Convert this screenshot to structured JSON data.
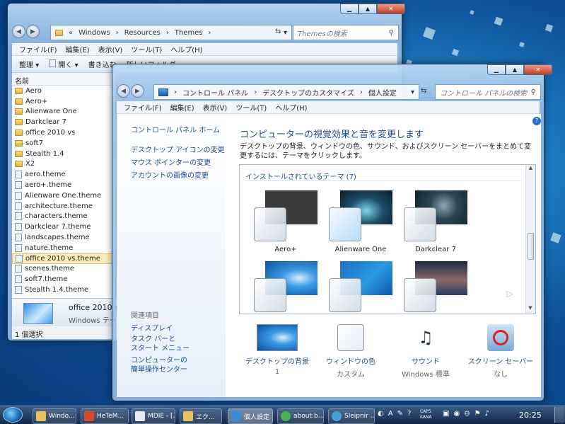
{
  "explorer": {
    "breadcrumb": [
      "«",
      "Windows",
      "Resources",
      "Themes"
    ],
    "search_placeholder": "Themesの検索",
    "menu": [
      "ファイル(F)",
      "編集(E)",
      "表示(V)",
      "ツール(T)",
      "ヘルプ(H)"
    ],
    "toolbar": {
      "organize": "整理",
      "open": "開く",
      "burn": "書き込む",
      "new_folder": "新しいフォルダー"
    },
    "column_name": "名前",
    "items": [
      {
        "name": "Aero",
        "type": "folder"
      },
      {
        "name": "Aero+",
        "type": "folder"
      },
      {
        "name": "Alienware One",
        "type": "folder"
      },
      {
        "name": "Darkclear 7",
        "type": "folder"
      },
      {
        "name": "office 2010 vs",
        "type": "folder"
      },
      {
        "name": "soft7",
        "type": "folder"
      },
      {
        "name": "Stealth 1.4",
        "type": "folder"
      },
      {
        "name": "X2",
        "type": "folder"
      },
      {
        "name": "aero.theme",
        "type": "file"
      },
      {
        "name": "aero+.theme",
        "type": "file"
      },
      {
        "name": "Alienware One.theme",
        "type": "file"
      },
      {
        "name": "architecture.theme",
        "type": "file"
      },
      {
        "name": "characters.theme",
        "type": "file"
      },
      {
        "name": "Darkclear 7.theme",
        "type": "file"
      },
      {
        "name": "landscapes.theme",
        "type": "file"
      },
      {
        "name": "nature.theme",
        "type": "file"
      },
      {
        "name": "office 2010 vs.theme",
        "type": "file",
        "selected": true
      },
      {
        "name": "scenes.theme",
        "type": "file"
      },
      {
        "name": "soft7.theme",
        "type": "file"
      },
      {
        "name": "Stealth 1.4.theme",
        "type": "file"
      }
    ],
    "details": {
      "name": "office 2010 vs.th",
      "type": "Windows テーマ"
    },
    "status": "1 個選択"
  },
  "control_panel": {
    "breadcrumb": [
      "コントロール パネル",
      "デスクトップのカスタマイズ",
      "個人設定"
    ],
    "search_placeholder": "コントロール パネルの検索",
    "menu": [
      "ファイル(F)",
      "編集(E)",
      "表示(V)",
      "ツール(T)",
      "ヘルプ(H)"
    ],
    "sidebar": {
      "home": "コントロール パネル ホーム",
      "links": [
        "デスクトップ アイコンの変更",
        "マウス ポインターの変更",
        "アカウントの画像の変更"
      ],
      "related_title": "関連項目",
      "related": [
        "ディスプレイ",
        "タスク バーと\nスタート メニュー",
        "コンピューターの\n簡単操作センター"
      ]
    },
    "title": "コンピューターの視覚効果と音を変更します",
    "description": "デスクトップの背景、ウィンドウの色、サウンド、およびスクリーン セーバーをまとめて変更するには、テーマをクリックします。",
    "section_title": "インストールされているテーマ (7)",
    "themes": [
      "Aero+",
      "Alienware One",
      "Darkclear 7",
      "",
      "",
      ""
    ],
    "bottom": [
      {
        "label": "デスクトップの背景",
        "value": "1"
      },
      {
        "label": "ウィンドウの色",
        "value": "カスタム"
      },
      {
        "label": "サウンド",
        "value": "Windows 標準"
      },
      {
        "label": "スクリーン セーバー",
        "value": "なし"
      }
    ]
  },
  "taskbar": {
    "buttons": [
      "Windo...",
      "HeTeM...",
      "MDIE - [...",
      "エク...",
      "個人設定",
      "about:b...",
      "Sleipnir ..."
    ],
    "tray": {
      "caps": "CAPS",
      "kana": "KANA",
      "time": "20:25"
    }
  }
}
